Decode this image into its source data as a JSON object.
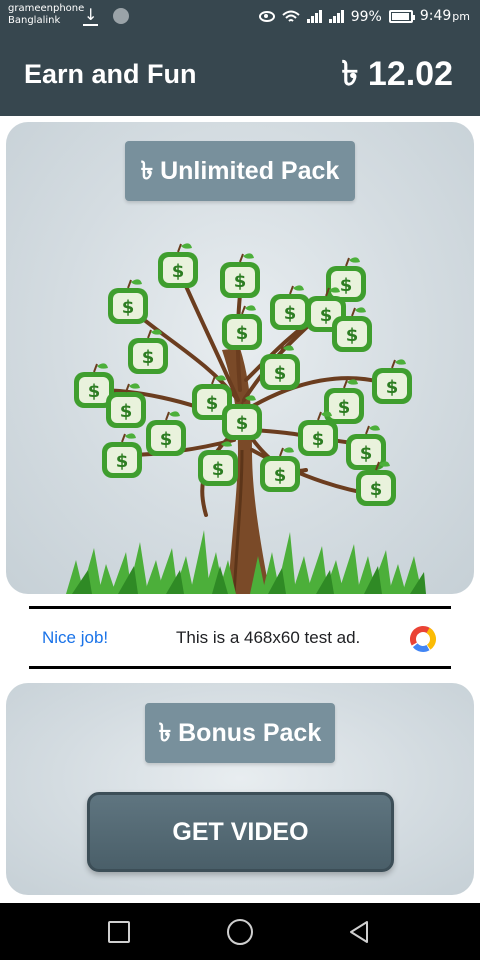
{
  "status_bar": {
    "carrier_1": "grameenphone",
    "carrier_2": "Banglalink",
    "battery": "99%",
    "time": "9:49",
    "time_suffix": "pm",
    "icons": [
      "download-icon",
      "circle-icon",
      "eye-icon",
      "wifi-icon",
      "signal-icon",
      "signal-icon",
      "battery-icon"
    ]
  },
  "app_bar": {
    "title": "Earn and Fun",
    "balance": "৳ 12.02",
    "color": "#37474f"
  },
  "unlimited_pack": {
    "label": "৳ Unlimited Pack",
    "image": "money-tree-illustration"
  },
  "ad": {
    "nice": "Nice job!",
    "text": "This is a 468x60 test ad.",
    "logo": "ad-logo-icon"
  },
  "bonus_pack": {
    "label": "৳ Bonus Pack",
    "get_video_label": "GET VIDEO"
  },
  "nav_bar": {
    "icons": [
      "recent-apps-icon",
      "home-icon",
      "back-icon"
    ]
  },
  "colors": {
    "accent": "#78909c",
    "card": "#d4dce1",
    "ad_blue": "#1a73e8"
  }
}
